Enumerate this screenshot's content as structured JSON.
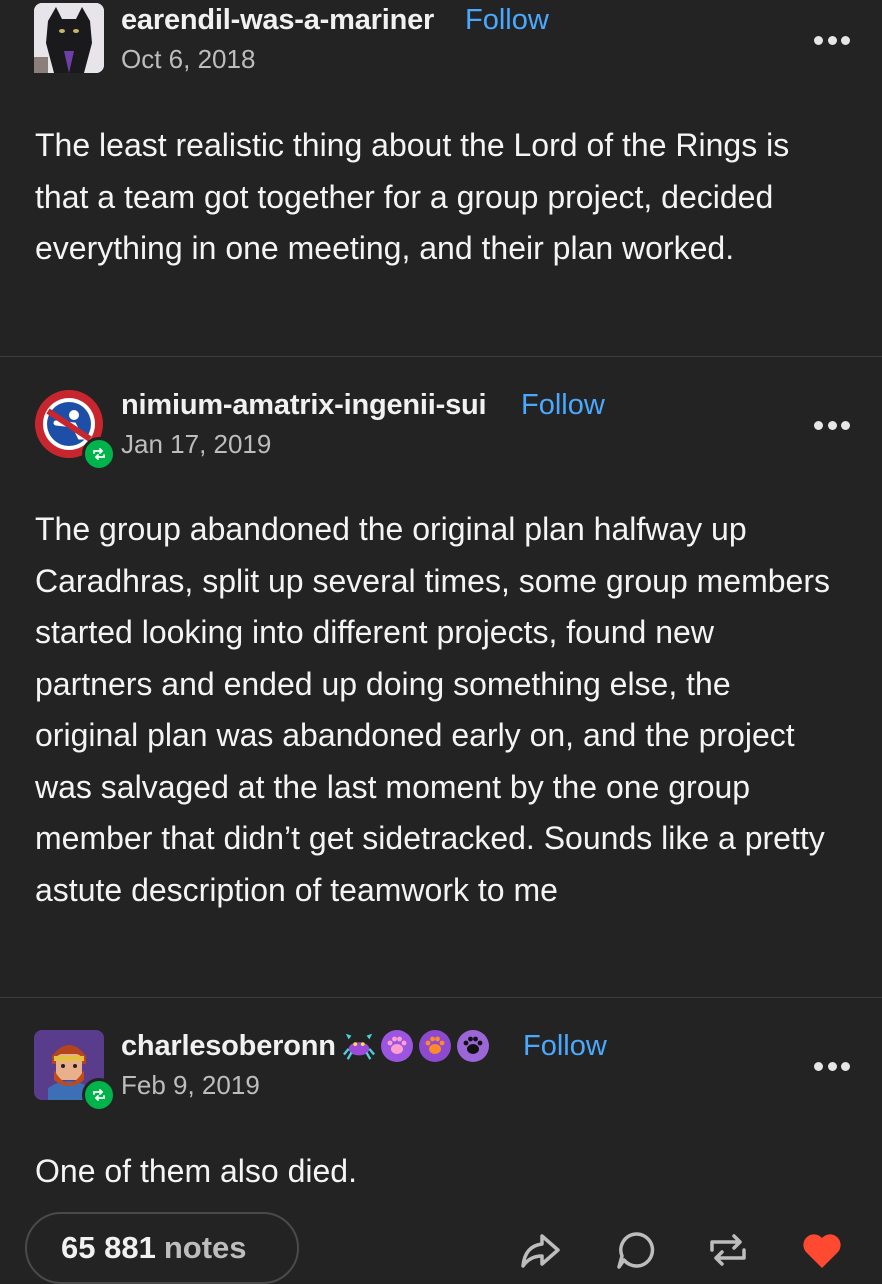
{
  "posts": [
    {
      "username": "earendil-was-a-mariner",
      "follow_label": "Follow",
      "date": "Oct 6, 2018",
      "avatar_icon": "black-cat-avatar",
      "body": "The least realistic thing about the Lord of the Rings is that a team got together for a group project, decided everything in one meeting, and their plan worked."
    },
    {
      "username": "nimium-amatrix-ingenii-sui",
      "follow_label": "Follow",
      "date": "Jan 17, 2019",
      "avatar_icon": "no-skating-sign-avatar",
      "body": "The group abandoned the original plan halfway up Caradhras, split up several times, some group members started looking into different projects, found new partners and ended up doing something else, the original plan was abandoned early on, and the project was salvaged at the last moment by the one group member that didn’t get sidetracked. Sounds like a pretty astute description of teamwork to me"
    },
    {
      "username": "charlesoberonn",
      "follow_label": "Follow",
      "date": "Feb 9, 2019",
      "avatar_icon": "red-bearded-man-avatar",
      "badges": [
        "crab-badge-icon",
        "pink-paw-badge-icon",
        "orange-paw-badge-icon",
        "black-paw-badge-icon"
      ],
      "body": "One of them also died."
    }
  ],
  "footer": {
    "notes_count": "65 881",
    "notes_label": "notes",
    "actions": [
      "share-icon",
      "reply-icon",
      "reblog-icon",
      "like-heart-icon"
    ]
  },
  "colors": {
    "background": "#232323",
    "follow": "#4aa8ff",
    "reblog_badge": "#00b34a",
    "heart": "#ff4930"
  }
}
